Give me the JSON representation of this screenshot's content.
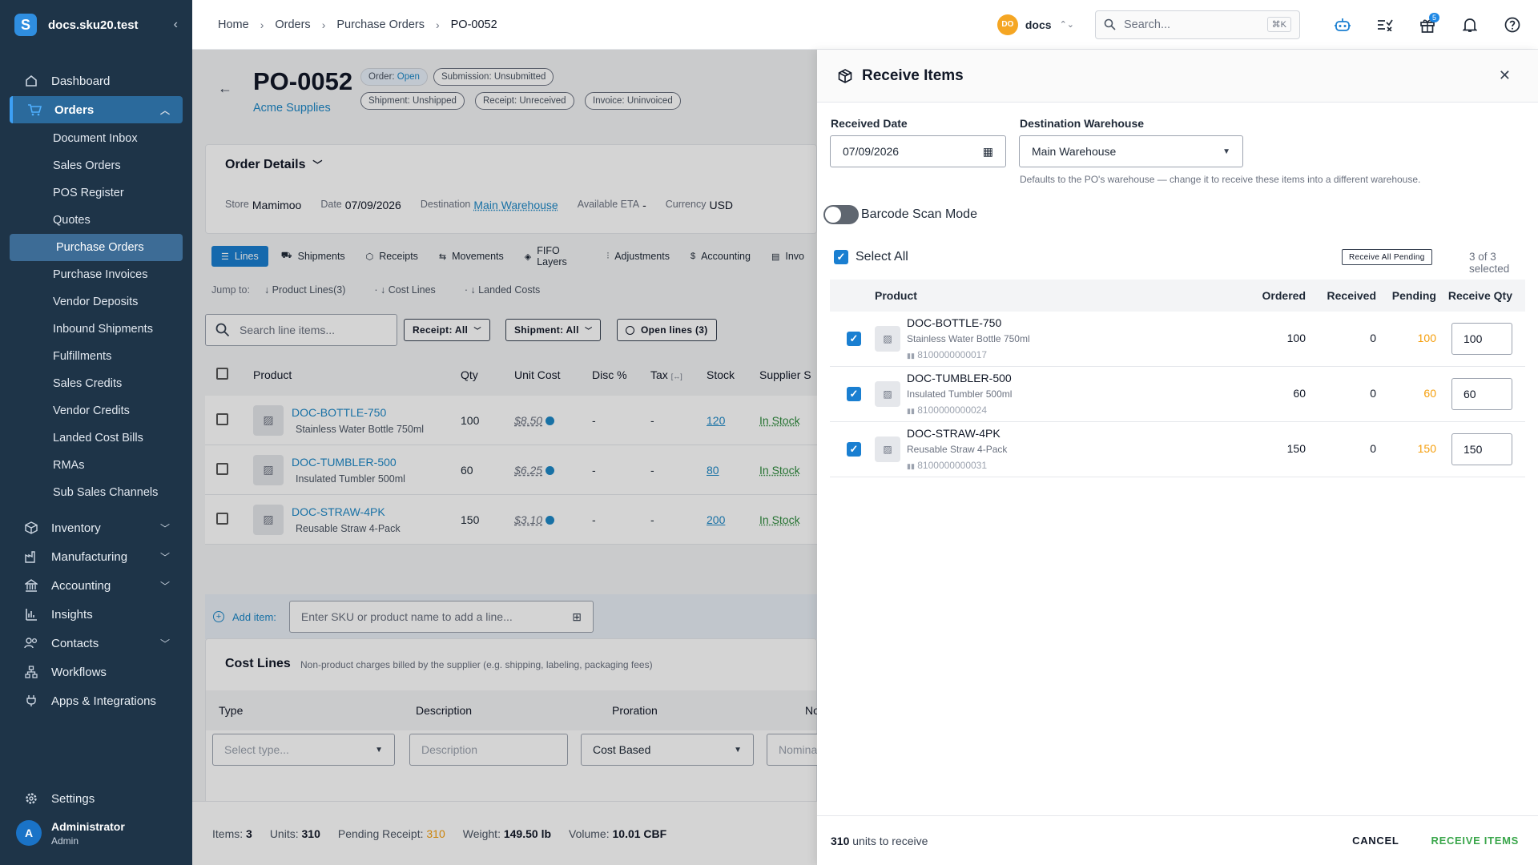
{
  "sidebar": {
    "brand_name": "docs.sku20.test",
    "items": [
      {
        "label": "Dashboard"
      },
      {
        "label": "Orders"
      },
      {
        "label": "Inventory"
      },
      {
        "label": "Manufacturing"
      },
      {
        "label": "Accounting"
      },
      {
        "label": "Insights"
      },
      {
        "label": "Contacts"
      },
      {
        "label": "Workflows"
      },
      {
        "label": "Apps & Integrations"
      }
    ],
    "orders_sub": [
      "Document Inbox",
      "Sales Orders",
      "POS Register",
      "Quotes",
      "Purchase Orders",
      "Purchase Invoices",
      "Vendor Deposits",
      "Inbound Shipments",
      "Fulfillments",
      "Sales Credits",
      "Vendor Credits",
      "Landed Cost Bills",
      "RMAs",
      "Sub Sales Channels"
    ],
    "settings": "Settings",
    "user": {
      "initial": "A",
      "name": "Administrator",
      "role": "Admin"
    }
  },
  "topbar": {
    "breadcrumbs": [
      "Home",
      "Orders",
      "Purchase Orders",
      "PO-0052"
    ],
    "org_initials": "DO",
    "org_name": "docs",
    "search_placeholder": "Search...",
    "search_shortcut": "⌘K",
    "notif_badge": "5"
  },
  "po": {
    "number": "PO-0052",
    "vendor": "Acme Supplies",
    "pills": {
      "order_k": "Order:",
      "order_v": "Open",
      "submission": "Submission: Unsubmitted",
      "shipment": "Shipment: Unshipped",
      "receipt": "Receipt: Unreceived",
      "invoice": "Invoice: Uninvoiced"
    },
    "details_title": "Order Details",
    "details": {
      "store_k": "Store",
      "store_v": "Mamimoo",
      "date_k": "Date",
      "date_v": "07/09/2026",
      "dest_k": "Destination",
      "dest_v": "Main Warehouse",
      "eta_k": "Available ETA",
      "eta_v": "-",
      "cur_k": "Currency",
      "cur_v": "USD"
    },
    "tabs": [
      "Lines",
      "Shipments",
      "Receipts",
      "Movements",
      "FIFO Layers",
      "Adjustments",
      "Accounting",
      "Invo"
    ],
    "jump": {
      "label": "Jump to:",
      "links": [
        "Product Lines(3)",
        "Cost Lines",
        "Landed Costs"
      ]
    },
    "line_search_placeholder": "Search line items...",
    "filters": [
      "Receipt: All",
      "Shipment: All",
      "Open lines (3)"
    ],
    "table_headers": [
      "Product",
      "Qty",
      "Unit Cost",
      "Disc %",
      "Tax",
      "Stock",
      "Supplier S"
    ],
    "lines": [
      {
        "sku": "DOC-BOTTLE-750",
        "name": "Stainless Water Bottle 750ml",
        "qty": "100",
        "cost": "$8.50",
        "disc": "-",
        "tax": "-",
        "stock": "120",
        "supplier": "In Stock"
      },
      {
        "sku": "DOC-TUMBLER-500",
        "name": "Insulated Tumbler 500ml",
        "qty": "60",
        "cost": "$6.25",
        "disc": "-",
        "tax": "-",
        "stock": "80",
        "supplier": "In Stock"
      },
      {
        "sku": "DOC-STRAW-4PK",
        "name": "Reusable Straw 4-Pack",
        "qty": "150",
        "cost": "$3.10",
        "disc": "-",
        "tax": "-",
        "stock": "200",
        "supplier": "In Stock"
      }
    ],
    "add_item_label": "Add item:",
    "add_item_placeholder": "Enter SKU or product name to add a line...",
    "cost_lines": {
      "title": "Cost Lines",
      "desc": "Non-product charges billed by the supplier (e.g. shipping, labeling, packaging fees)",
      "headers": [
        "Type",
        "Description",
        "Proration",
        "Nominal"
      ],
      "type_placeholder": "Select type...",
      "desc_placeholder": "Description",
      "proration_value": "Cost Based",
      "nominal_placeholder": "Nomina"
    },
    "footer": {
      "items_k": "Items:",
      "items_v": "3",
      "units_k": "Units:",
      "units_v": "310",
      "pending_k": "Pending Receipt:",
      "pending_v": "310",
      "weight_k": "Weight:",
      "weight_v": "149.50 lb",
      "volume_k": "Volume:",
      "volume_v": "10.01 CBF"
    }
  },
  "drawer": {
    "title": "Receive Items",
    "received_date_label": "Received Date",
    "received_date_value": "07/09/2026",
    "warehouse_label": "Destination Warehouse",
    "warehouse_value": "Main Warehouse",
    "warehouse_hint": "Defaults to the PO's warehouse — change it to receive these items into a different warehouse.",
    "barcode_label": "Barcode Scan Mode",
    "select_all": "Select All",
    "receive_all_pending": "Receive All Pending",
    "selected_count": "3 of 3 selected",
    "headers": [
      "Product",
      "Ordered",
      "Received",
      "Pending",
      "Receive Qty"
    ],
    "rows": [
      {
        "sku": "DOC-BOTTLE-750",
        "name": "Stainless Water Bottle 750ml",
        "barcode": "8100000000017",
        "ordered": "100",
        "received": "0",
        "pending": "100",
        "qty": "100"
      },
      {
        "sku": "DOC-TUMBLER-500",
        "name": "Insulated Tumbler 500ml",
        "barcode": "8100000000024",
        "ordered": "60",
        "received": "0",
        "pending": "60",
        "qty": "60"
      },
      {
        "sku": "DOC-STRAW-4PK",
        "name": "Reusable Straw 4-Pack",
        "barcode": "8100000000031",
        "ordered": "150",
        "received": "0",
        "pending": "150",
        "qty": "150"
      }
    ],
    "footer_units": "310",
    "footer_units_suffix": " units to receive",
    "cancel": "CANCEL",
    "receive": "RECEIVE ITEMS"
  },
  "colors": {
    "accent": "#1a7fd1",
    "sidebar_bg": "#1e3448",
    "pending": "#f59e0b",
    "instock": "#2e8b3d",
    "receive_button": "#3aa64b"
  }
}
